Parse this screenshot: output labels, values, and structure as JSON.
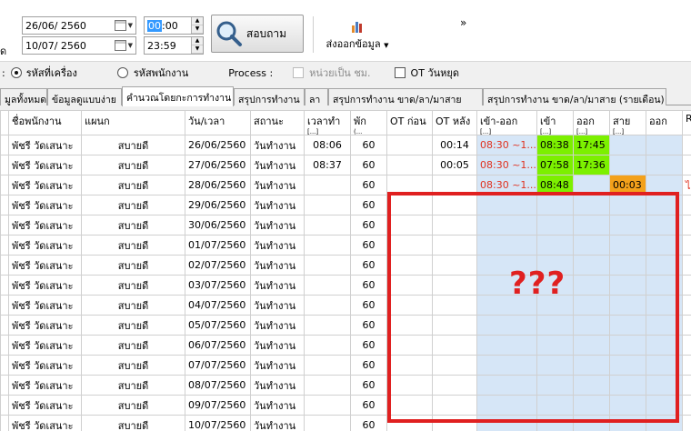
{
  "filters": {
    "date_from": "26/06/ 2560",
    "date_to": "10/07/  2560",
    "time_from_hl": "00",
    "time_from_rest": ":00",
    "time_to": "23:59",
    "partial_label": "ด",
    "search_label": "สอบถาม",
    "export_label": "ส่งออกข้อมูล",
    "more": "»"
  },
  "options": {
    "colon": ":",
    "radio_machine": "รหัสที่เครื่อง",
    "radio_employee": "รหัสพนักงาน",
    "process_label": "Process :",
    "unit_hours": "หน่วยเป็น ชม.",
    "ot_holiday": "OT วันหยุด"
  },
  "tabs": [
    "มูลทั้งหมด",
    "ข้อมูลดูแบบง่าย",
    "คำนวณโดยกะการทำงาน",
    "สรุปการทำงาน",
    "ลา",
    "สรุปการทำงาน ขาด/ลา/มาสาย",
    "สรุปการทำงาน ขาด/ลา/มาสาย (รายเดือน)"
  ],
  "columns": [
    "ชื่อพนักงาน",
    "แผนก",
    "วัน/เวลา",
    "สถานะ",
    "เวลาทำ",
    "พัก",
    "OT ก่อน",
    "OT หลัง",
    "เข้า-ออก",
    "เข้า",
    "ออก",
    "สาย",
    "ออก",
    "R"
  ],
  "column_subs": [
    "",
    "",
    "",
    "",
    "[...]",
    "(...",
    "",
    "",
    "[...]",
    "[...]",
    "[...]",
    "[...]",
    "",
    ""
  ],
  "rows": [
    {
      "name": "พัชรี วัดเสนาะ",
      "dept": "สบายดี",
      "date": "26/06/2560",
      "status": "วันทำงาน",
      "work": "08:06",
      "brk": "60",
      "ot_before": "",
      "ot_after": "00:14",
      "shift": "08:30 ~1...",
      "in": "08:38",
      "out": "17:45",
      "late": "",
      "early": "",
      "r": ""
    },
    {
      "name": "พัชรี วัดเสนาะ",
      "dept": "สบายดี",
      "date": "27/06/2560",
      "status": "วันทำงาน",
      "work": "08:37",
      "brk": "60",
      "ot_before": "",
      "ot_after": "00:05",
      "shift": "08:30 ~1...",
      "in": "07:58",
      "out": "17:36",
      "late": "",
      "early": "",
      "r": ""
    },
    {
      "name": "พัชรี วัดเสนาะ",
      "dept": "สบายดี",
      "date": "28/06/2560",
      "status": "วันทำงาน",
      "work": "",
      "brk": "60",
      "ot_before": "",
      "ot_after": "",
      "shift": "08:30 ~1...",
      "in": "08:48",
      "out": "",
      "late": "00:03",
      "early": "",
      "r": "ไ"
    },
    {
      "name": "พัชรี วัดเสนาะ",
      "dept": "สบายดี",
      "date": "29/06/2560",
      "status": "วันทำงาน",
      "work": "",
      "brk": "60",
      "ot_before": "",
      "ot_after": "",
      "shift": "",
      "in": "",
      "out": "",
      "late": "",
      "early": "",
      "r": ""
    },
    {
      "name": "พัชรี วัดเสนาะ",
      "dept": "สบายดี",
      "date": "30/06/2560",
      "status": "วันทำงาน",
      "work": "",
      "brk": "60",
      "ot_before": "",
      "ot_after": "",
      "shift": "",
      "in": "",
      "out": "",
      "late": "",
      "early": "",
      "r": ""
    },
    {
      "name": "พัชรี วัดเสนาะ",
      "dept": "สบายดี",
      "date": "01/07/2560",
      "status": "วันทำงาน",
      "work": "",
      "brk": "60",
      "ot_before": "",
      "ot_after": "",
      "shift": "",
      "in": "",
      "out": "",
      "late": "",
      "early": "",
      "r": ""
    },
    {
      "name": "พัชรี วัดเสนาะ",
      "dept": "สบายดี",
      "date": "02/07/2560",
      "status": "วันทำงาน",
      "work": "",
      "brk": "60",
      "ot_before": "",
      "ot_after": "",
      "shift": "",
      "in": "",
      "out": "",
      "late": "",
      "early": "",
      "r": ""
    },
    {
      "name": "พัชรี วัดเสนาะ",
      "dept": "สบายดี",
      "date": "03/07/2560",
      "status": "วันทำงาน",
      "work": "",
      "brk": "60",
      "ot_before": "",
      "ot_after": "",
      "shift": "",
      "in": "",
      "out": "",
      "late": "",
      "early": "",
      "r": ""
    },
    {
      "name": "พัชรี วัดเสนาะ",
      "dept": "สบายดี",
      "date": "04/07/2560",
      "status": "วันทำงาน",
      "work": "",
      "brk": "60",
      "ot_before": "",
      "ot_after": "",
      "shift": "",
      "in": "",
      "out": "",
      "late": "",
      "early": "",
      "r": ""
    },
    {
      "name": "พัชรี วัดเสนาะ",
      "dept": "สบายดี",
      "date": "05/07/2560",
      "status": "วันทำงาน",
      "work": "",
      "brk": "60",
      "ot_before": "",
      "ot_after": "",
      "shift": "",
      "in": "",
      "out": "",
      "late": "",
      "early": "",
      "r": ""
    },
    {
      "name": "พัชรี วัดเสนาะ",
      "dept": "สบายดี",
      "date": "06/07/2560",
      "status": "วันทำงาน",
      "work": "",
      "brk": "60",
      "ot_before": "",
      "ot_after": "",
      "shift": "",
      "in": "",
      "out": "",
      "late": "",
      "early": "",
      "r": ""
    },
    {
      "name": "พัชรี วัดเสนาะ",
      "dept": "สบายดี",
      "date": "07/07/2560",
      "status": "วันทำงาน",
      "work": "",
      "brk": "60",
      "ot_before": "",
      "ot_after": "",
      "shift": "",
      "in": "",
      "out": "",
      "late": "",
      "early": "",
      "r": ""
    },
    {
      "name": "พัชรี วัดเสนาะ",
      "dept": "สบายดี",
      "date": "08/07/2560",
      "status": "วันทำงาน",
      "work": "",
      "brk": "60",
      "ot_before": "",
      "ot_after": "",
      "shift": "",
      "in": "",
      "out": "",
      "late": "",
      "early": "",
      "r": ""
    },
    {
      "name": "พัชรี วัดเสนาะ",
      "dept": "สบายดี",
      "date": "09/07/2560",
      "status": "วันทำงาน",
      "work": "",
      "brk": "60",
      "ot_before": "",
      "ot_after": "",
      "shift": "",
      "in": "",
      "out": "",
      "late": "",
      "early": "",
      "r": ""
    },
    {
      "name": "พัชรี วัดเสนาะ",
      "dept": "สบายดี",
      "date": "10/07/2560",
      "status": "วันทำงาน",
      "work": "",
      "brk": "60",
      "ot_before": "",
      "ot_after": "",
      "shift": "",
      "in": "",
      "out": "",
      "late": "",
      "early": "",
      "r": ""
    }
  ],
  "annotation": "???",
  "colors": {
    "accent": "#3399ff",
    "late_orange": "#f3a11b",
    "inout_green": "#7cf000",
    "shift_blue": "#d6e6f7",
    "shift_red": "#e0301e",
    "annotation_red": "#e02020"
  }
}
